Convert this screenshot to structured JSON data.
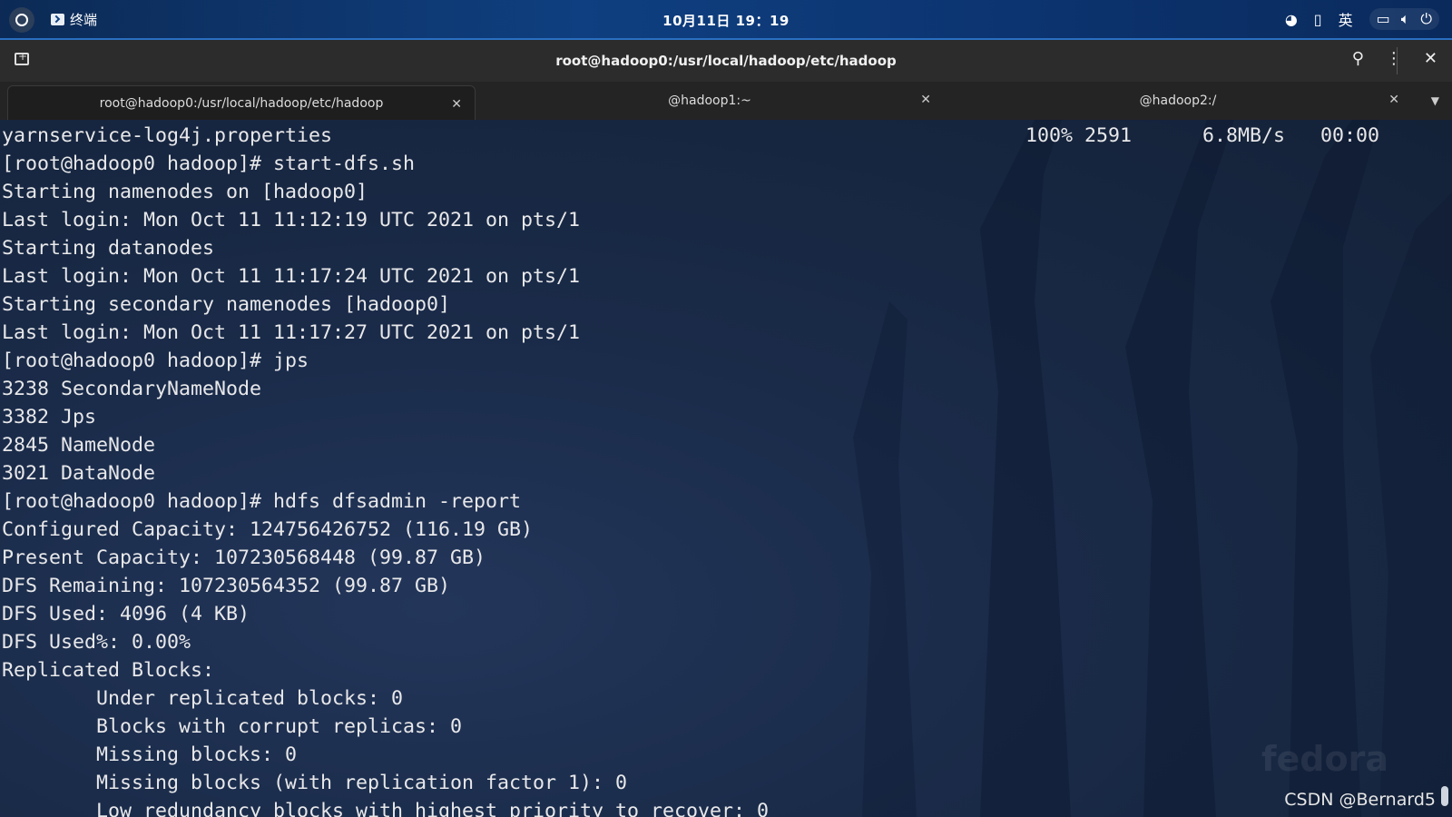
{
  "topbar": {
    "app_name": "终端",
    "clock": "10月11日 19：19",
    "tray": {
      "input_method": "英"
    }
  },
  "window": {
    "title": "root@hadoop0:/usr/local/hadoop/etc/hadoop"
  },
  "tabs": [
    {
      "label": "root@hadoop0:/usr/local/hadoop/etc/hadoop",
      "active": true
    },
    {
      "label": "@hadoop1:~",
      "active": false
    },
    {
      "label": "@hadoop2:/",
      "active": false
    }
  ],
  "terminal": {
    "lines": [
      "yarnservice-log4j.properties",
      "[root@hadoop0 hadoop]# start-dfs.sh",
      "Starting namenodes on [hadoop0]",
      "Last login: Mon Oct 11 11:12:19 UTC 2021 on pts/1",
      "Starting datanodes",
      "Last login: Mon Oct 11 11:17:24 UTC 2021 on pts/1",
      "Starting secondary namenodes [hadoop0]",
      "Last login: Mon Oct 11 11:17:27 UTC 2021 on pts/1",
      "[root@hadoop0 hadoop]# jps",
      "3238 SecondaryNameNode",
      "3382 Jps",
      "2845 NameNode",
      "3021 DataNode",
      "[root@hadoop0 hadoop]# hdfs dfsadmin -report",
      "Configured Capacity: 124756426752 (116.19 GB)",
      "Present Capacity: 107230568448 (99.87 GB)",
      "DFS Remaining: 107230564352 (99.87 GB)",
      "DFS Used: 4096 (4 KB)",
      "DFS Used%: 0.00%",
      "Replicated Blocks:",
      "        Under replicated blocks: 0",
      "        Blocks with corrupt replicas: 0",
      "        Missing blocks: 0",
      "        Missing blocks (with replication factor 1): 0",
      "        Low redundancy blocks with highest priority to recover: 0"
    ],
    "transfer_status": "100% 2591      6.8MB/s   00:00",
    "fedora_logo_text": "fedora"
  },
  "watermark": "CSDN @Bernard5"
}
